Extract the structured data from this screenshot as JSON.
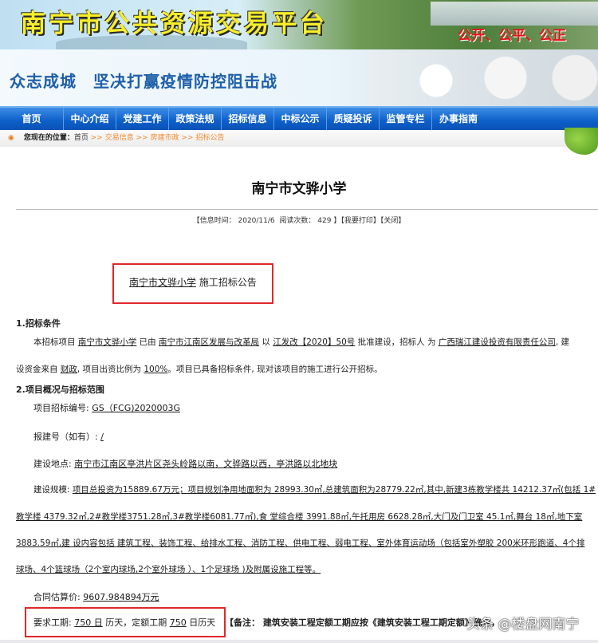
{
  "header": {
    "site_title": "南宁市公共资源交易平台",
    "slogan": "公开、公平、公正",
    "banner_slogan": "众志成城　坚决打赢疫情防控阻击战"
  },
  "nav": [
    "首页",
    "中心介绍",
    "党建工作",
    "政策法规",
    "招标信息",
    "中标公示",
    "质疑投诉",
    "监管专栏",
    "办事指南"
  ],
  "breadcrumb": {
    "label": "您现在的位置：",
    "home": "首页",
    "sep": ">>",
    "items": [
      "交易信息",
      "房建市政",
      "招标公告"
    ]
  },
  "article": {
    "title": "南宁市文骅小学",
    "meta": {
      "time_label": "【信息时间：",
      "time": "2020/11/6",
      "reads_label": "阅读次数：",
      "reads": "429",
      "reads_end": "】",
      "print": "【我要打印】",
      "close": "【关闭】"
    },
    "notice": {
      "project": "南宁市文骅小学",
      "suffix": " 施工招标公告"
    },
    "s1": {
      "heading": "1.招标条件",
      "p1": [
        "本招标项目 ",
        "南宁市文骅小学",
        " 已由 ",
        "南宁市江南区发展与改革局",
        " 以 ",
        "江发改【2020】50号",
        " 批准建设，招标人 为 ",
        "广西瑞江建设投资有限责任公司",
        ", 建"
      ],
      "p2": [
        "设资金来自 ",
        "财政",
        ", 项目出资比例为 ",
        "100%",
        "。项目已具备招标条件, 现对该项目的施工进行公开招标。"
      ]
    },
    "s2": {
      "heading": "2.项目概况与招标范围",
      "code_label": "项目招标编号: ",
      "code": "GS（FCG)2020003G",
      "permit_label": "报建号（如有）: ",
      "permit": "/",
      "site_label": "建设地点: ",
      "site": "南宁市江南区亭洪片区尧头岭路以南，文骅路以西，亭洪路以北地块",
      "scale_label": "建设规模: ",
      "scale": [
        "项目总投资为15889.67万元；项目规划净用地面积为  28993.30㎡,总建筑面积为28779.22㎡,其中,新建3栋教学楼共  14212.37㎡(包括  1#",
        "教学楼   4379.32㎡,2#教学楼3751.28㎡,3#教学楼6081.77㎡),食  堂综合楼   3991.88㎡,午托用房   6628.28㎡,大门及门卫室   45.1㎡,舞台   18㎡,地下室",
        "3883.59㎡,建  设内容包括  建筑工程、装饰工程、给排水工程、消防工程、供电工程、弱电工程、室外体育运动场（包括室外塑胶  200米环形跑道、4个排",
        "球场、4个篮球场（2个室内球场,2个室外球场  ）、1个足球场  )及附属设施工程等。"
      ],
      "price_label": "合同估算价: ",
      "price": "9607.984894万元",
      "period_label": "要求工期: ",
      "period": "750 日",
      "period_mid": "  历天，定额工期  ",
      "quota": "750",
      "period_end": "  日历天",
      "note": "【备注：  建筑安装工程定额工期应按《建筑安装工程工期定额》确定，"
    }
  },
  "watermark": "头条 @楼盘网南宁",
  "colors": {
    "nav": "#0d5fc9",
    "highlight": "#e0272b",
    "crumb_link": "#f08a2c"
  }
}
